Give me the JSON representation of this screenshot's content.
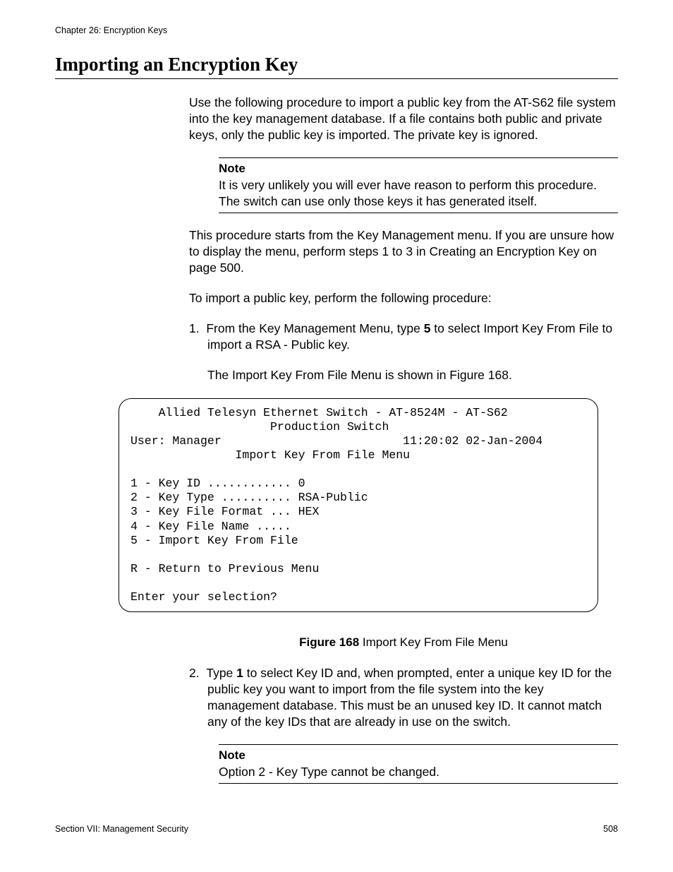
{
  "header": {
    "chapter": "Chapter 26: Encryption Keys"
  },
  "title": "Importing an Encryption Key",
  "intro": "Use the following procedure to import a public key from the AT-S62 file system into the key management database. If a file contains both public and private keys, only the public key is imported. The private key is ignored.",
  "note1": {
    "label": "Note",
    "text": "It is very unlikely you will ever have reason to perform this procedure. The switch can use only those keys it has generated itself."
  },
  "para2": "This procedure starts from the Key Management menu. If you are unsure how to display the menu, perform steps 1 to 3 in Creating an Encryption Key on page 500.",
  "para3": "To import a public key, perform the following procedure:",
  "step1": {
    "num": "1.",
    "pre": "From the Key Management Menu, type ",
    "bold": "5",
    "post": " to select Import Key From File to import a RSA - Public key.",
    "cont": "The Import Key From File Menu is shown in Figure 168."
  },
  "terminal": {
    "l1": "    Allied Telesyn Ethernet Switch - AT-8524M - AT-S62",
    "l2": "                    Production Switch",
    "l3": "User: Manager                          11:20:02 02-Jan-2004",
    "l4": "               Import Key From File Menu",
    "l5": "",
    "l6": "1 - Key ID ............ 0",
    "l7": "2 - Key Type .......... RSA-Public",
    "l8": "3 - Key File Format ... HEX",
    "l9": "4 - Key File Name .....",
    "l10": "5 - Import Key From File",
    "l11": "",
    "l12": "R - Return to Previous Menu",
    "l13": "",
    "l14": "Enter your selection?"
  },
  "figcap": {
    "bold": "Figure 168",
    "rest": "  Import Key From File Menu"
  },
  "step2": {
    "num": "2.",
    "pre": "Type ",
    "bold": "1",
    "post": " to select Key ID and, when prompted, enter a unique key ID for the public key you want to import from the file system into the key management database. This must be an unused key ID. It cannot match any of the key IDs that are already in use on the switch."
  },
  "note2": {
    "label": "Note",
    "text": "Option 2 - Key Type cannot be changed."
  },
  "footer": {
    "section": "Section VII: Management Security",
    "page": "508"
  }
}
